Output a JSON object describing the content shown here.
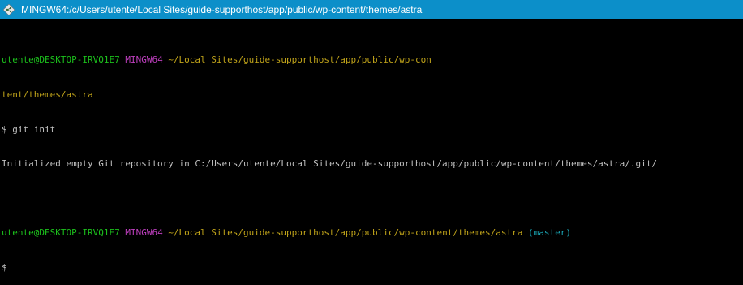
{
  "window": {
    "title": "MINGW64:/c/Users/utente/Local Sites/guide-supporthost/app/public/wp-content/themes/astra",
    "icon": "mingw-git-icon",
    "title_bar_color": "#0c8fc9"
  },
  "terminal": {
    "colors": {
      "background": "#000000",
      "user": "#1cc01c",
      "system": "#bf3fbf",
      "path": "#c1a41a",
      "branch": "#1aa6b5",
      "text": "#c0c0c0"
    },
    "prompt1": {
      "user_host": "utente@DESKTOP-IRVQ1E7",
      "system": "MINGW64",
      "path_line1": "~/Local Sites/guide-supporthost/app/public/wp-con",
      "path_line2": "tent/themes/astra"
    },
    "command1": "$ git init",
    "output1": "Initialized empty Git repository in C:/Users/utente/Local Sites/guide-supporthost/app/public/wp-content/themes/astra/.git/",
    "prompt2": {
      "user_host": "utente@DESKTOP-IRVQ1E7",
      "system": "MINGW64",
      "path": "~/Local Sites/guide-supporthost/app/public/wp-content/themes/astra",
      "branch": "(master)"
    },
    "prompt_symbol": "$"
  }
}
